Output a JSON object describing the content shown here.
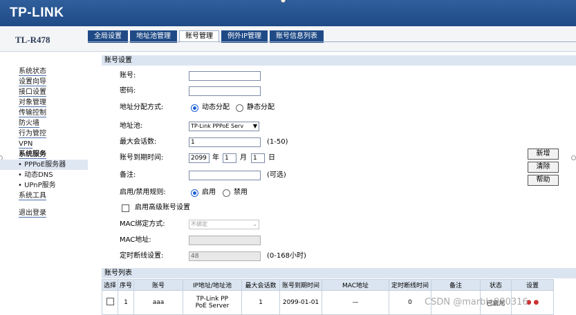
{
  "app": {
    "logo": "TP-LINK",
    "model": "TL-R478"
  },
  "tabs": [
    {
      "label": "全局设置"
    },
    {
      "label": "地址池管理"
    },
    {
      "label": "账号管理"
    },
    {
      "label": "例外IP管理"
    },
    {
      "label": "账号信息列表"
    }
  ],
  "sidebar": {
    "items": [
      {
        "label": "系统状态"
      },
      {
        "label": "设置向导"
      },
      {
        "label": "接口设置"
      },
      {
        "label": "对象管理"
      },
      {
        "label": "传输控制"
      },
      {
        "label": "防火墙"
      },
      {
        "label": "行为管控"
      },
      {
        "label": "VPN"
      },
      {
        "label": "系统服务"
      },
      {
        "label": "• PPPoE服务器"
      },
      {
        "label": "• 动态DNS"
      },
      {
        "label": "• UPnP服务"
      },
      {
        "label": "系统工具"
      },
      {
        "label": "退出登录"
      }
    ]
  },
  "form": {
    "section_title": "账号设置",
    "account_label": "账号:",
    "account_value": "",
    "password_label": "密码:",
    "password_value": "",
    "alloc_label": "地址分配方式:",
    "alloc_dynamic": "动态分配",
    "alloc_static": "静态分配",
    "pool_label": "地址池:",
    "pool_value": "TP-Link PPPoE Serv",
    "max_sessions_label": "最大会话数:",
    "max_sessions_value": "1",
    "max_sessions_hint": "(1-50)",
    "expiry_label": "账号到期时间:",
    "expiry_year": "2099",
    "year_unit": "年",
    "expiry_month": "1",
    "month_unit": "月",
    "expiry_day": "1",
    "day_unit": "日",
    "note_label": "备注:",
    "note_value": "",
    "note_hint": "(可选)",
    "rule_label": "启用/禁用规则:",
    "rule_enable": "启用",
    "rule_disable": "禁用",
    "advanced_label": "启用高级账号设置",
    "mac_bind_label": "MAC绑定方式:",
    "mac_bind_value": "不绑定",
    "mac_label": "MAC地址:",
    "mac_value": "",
    "timeout_label": "定时断线设置:",
    "timeout_value": "48",
    "timeout_hint": "(0-168小时)"
  },
  "buttons": {
    "new": "新增",
    "clear": "清除",
    "help": "帮助"
  },
  "list": {
    "section_title": "账号列表",
    "columns": [
      "选择",
      "序号",
      "账号",
      "IP地址/地址池",
      "最大会话数",
      "账号到期时间",
      "MAC地址",
      "定时断线时间",
      "备注",
      "状态",
      "设置"
    ],
    "rows": [
      {
        "index": "1",
        "account": "aaa",
        "pool_line1": "TP-Link PP",
        "pool_line2": "PoE Server",
        "max": "1",
        "expiry": "2099-01-01",
        "mac": "—",
        "timeout": "0",
        "note": "",
        "status": "已启用"
      }
    ]
  },
  "watermark": "CSDN @marble980316"
}
